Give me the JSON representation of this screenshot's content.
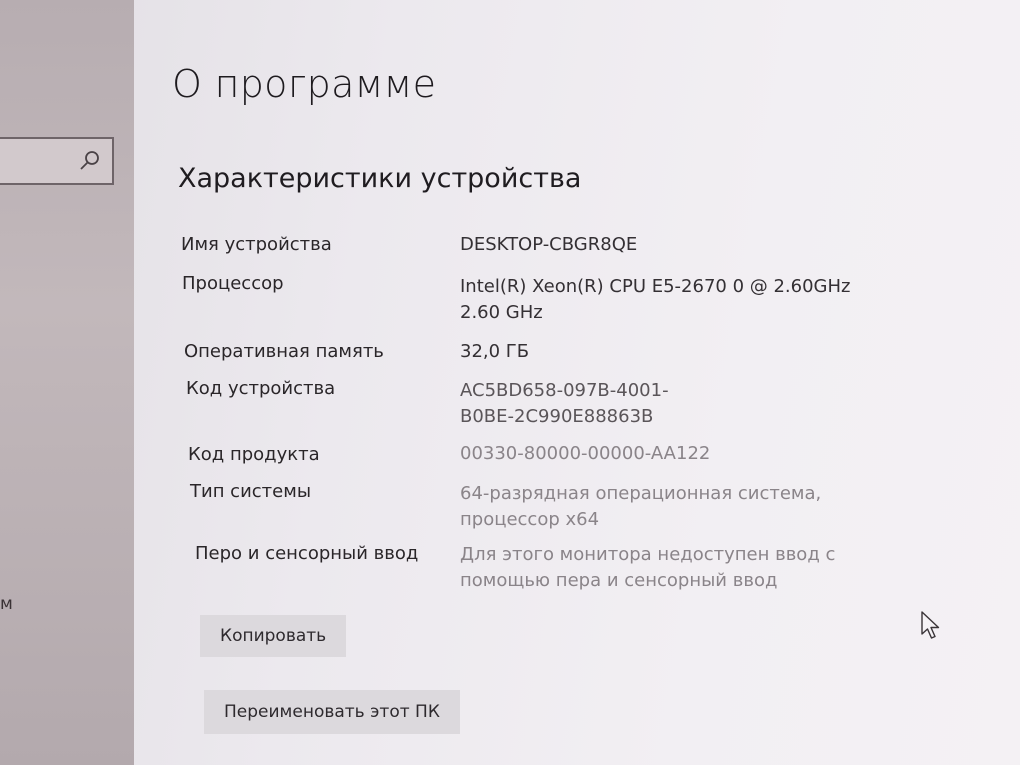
{
  "nav": {
    "search_value": "",
    "fragment_text": "м"
  },
  "page": {
    "title": "О программе",
    "section_title": "Характеристики устройства"
  },
  "specs": [
    {
      "label": "Имя устройства",
      "value_lines": [
        "DESKTOP-CBGR8QE"
      ]
    },
    {
      "label": "Процессор",
      "value_lines": [
        "Intel(R) Xeon(R) CPU E5-2670 0 @ 2.60GHz",
        "2.60 GHz"
      ]
    },
    {
      "label": "Оперативная память",
      "value_lines": [
        "32,0 ГБ"
      ]
    },
    {
      "label": "Код устройства",
      "value_lines": [
        "AC5BD658-097B-4001-",
        "B0BE-2C990E88863B"
      ]
    },
    {
      "label": "Код продукта",
      "value_lines": [
        "00330-80000-00000-AA122"
      ]
    },
    {
      "label": "Тип системы",
      "value_lines": [
        "64-разрядная операционная система,",
        "процессор x64"
      ]
    },
    {
      "label": "Перо и сенсорный ввод",
      "value_lines": [
        "Для этого монитора недоступен ввод с",
        "помощью пера и сенсорный ввод"
      ]
    }
  ],
  "buttons": {
    "copy_label": "Копировать",
    "rename_label": "Переименовать этот ПК"
  },
  "icons": {
    "search": "search-icon",
    "cursor": "mouse-pointer-icon"
  }
}
